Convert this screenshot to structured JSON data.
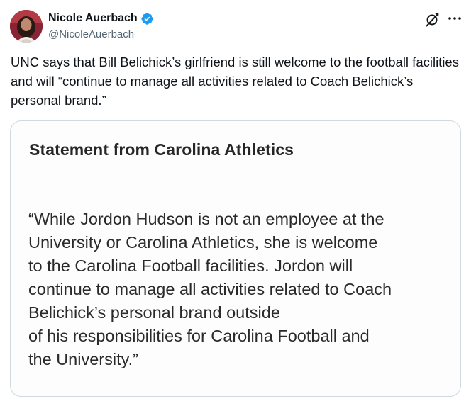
{
  "author": {
    "display_name": "Nicole Auerbach",
    "handle": "@NicoleAuerbach",
    "verified": true,
    "avatar_icon": "profile-photo",
    "verified_icon": "verified-badge-icon",
    "verified_color": "#1d9bf0"
  },
  "actions": {
    "grok_icon": "grok-icon",
    "more_icon": "more-options-icon"
  },
  "tweet": {
    "text": "UNC says that Bill Belichick’s girlfriend is still welcome to the football facilities and will “continue to manage all activities related to Coach Belichick’s personal brand.”"
  },
  "media": {
    "title": "Statement from Carolina Athletics",
    "body": "“While Jordon Hudson is not an employee at the\nUniversity or Carolina Athletics, she is welcome\nto the Carolina Football facilities. Jordon will\ncontinue to manage all activities related to Coach\nBelichick’s personal brand outside\n of his responsibilities for Carolina Football and\nthe University.”"
  },
  "colors": {
    "text_primary": "#0f1419",
    "text_secondary": "#536471",
    "card_border": "#cfd9de"
  }
}
